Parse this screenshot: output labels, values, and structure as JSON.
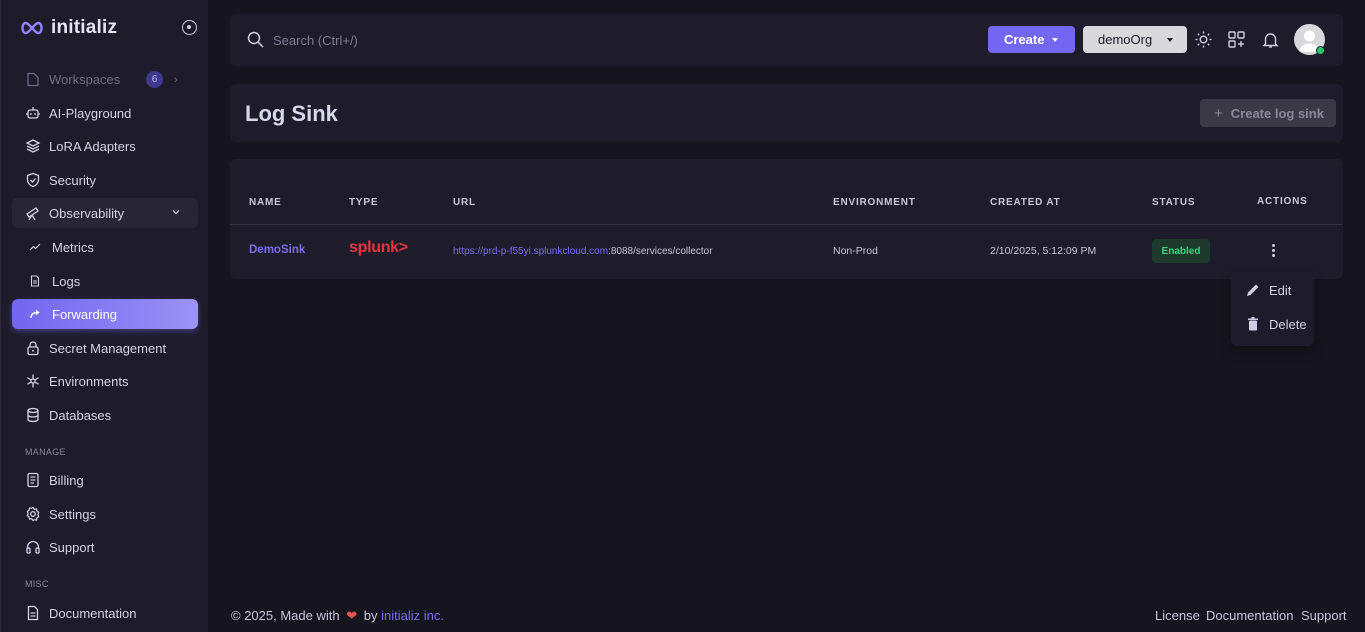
{
  "brand": {
    "name": "initializ"
  },
  "sidebar": {
    "items": [
      {
        "label": "Workspaces",
        "badge": "6",
        "icon": "file-icon"
      },
      {
        "label": "AI-Playground",
        "icon": "robot-icon"
      },
      {
        "label": "LoRA Adapters",
        "icon": "layers-icon"
      },
      {
        "label": "Security",
        "icon": "shield-check-icon"
      },
      {
        "label": "Observability",
        "icon": "telescope-icon"
      },
      {
        "label": "Metrics",
        "icon": "trend-icon"
      },
      {
        "label": "Logs",
        "icon": "log-file-icon"
      },
      {
        "label": "Forwarding",
        "icon": "arrow-forward-icon"
      },
      {
        "label": "Secret Management",
        "icon": "lock-icon"
      },
      {
        "label": "Environments",
        "icon": "snowflake-icon"
      },
      {
        "label": "Databases",
        "icon": "database-icon"
      },
      {
        "label": "Billing",
        "icon": "invoice-icon"
      },
      {
        "label": "Settings",
        "icon": "gear-icon"
      },
      {
        "label": "Support",
        "icon": "headset-icon"
      },
      {
        "label": "Documentation",
        "icon": "document-icon"
      }
    ],
    "sections": {
      "manage": "MANAGE",
      "misc": "MISC"
    }
  },
  "topbar": {
    "search_placeholder": "Search (Ctrl+/)",
    "create_label": "Create",
    "org_label": "demoOrg"
  },
  "page": {
    "title": "Log Sink",
    "create_button": "Create log sink"
  },
  "table": {
    "headers": {
      "name": "NAME",
      "type": "TYPE",
      "url": "URL",
      "environment": "ENVIRONMENT",
      "created_at": "CREATED AT",
      "status": "STATUS",
      "actions": "ACTIONS"
    },
    "rows": [
      {
        "name": "DemoSink",
        "type": "splunk>",
        "url_link": "https://prd-p-f55yi.splunkcloud.com",
        "url_rest": ":8088/services/collector",
        "environment": "Non-Prod",
        "created_at": "2/10/2025, 5:12:09 PM",
        "status": "Enabled"
      }
    ]
  },
  "menu": {
    "edit": "Edit",
    "delete": "Delete"
  },
  "footer": {
    "prefix": "© 2025, Made with",
    "by": "by",
    "company": "initializ inc.",
    "links": [
      "License",
      "Documentation",
      "Support"
    ]
  },
  "colors": {
    "accent": "#7366f0",
    "success": "#28c76f",
    "background": "#16151f",
    "card": "#1e1c2b"
  }
}
